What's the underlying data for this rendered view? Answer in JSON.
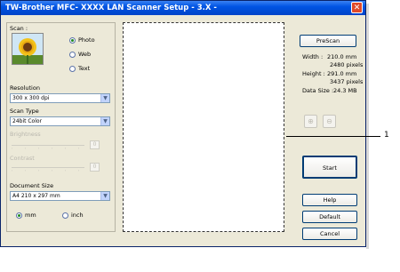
{
  "window": {
    "title": "TW-Brother MFC- XXXX     LAN Scanner Setup - 3.X -",
    "close_glyph": "✕"
  },
  "scan": {
    "label": "Scan :",
    "options": [
      "Photo",
      "Web",
      "Text"
    ],
    "selected": "Photo"
  },
  "resolution": {
    "label": "Resolution",
    "value": "300 x 300 dpi"
  },
  "scan_type": {
    "label": "Scan Type",
    "value": "24bit Color"
  },
  "brightness": {
    "label": "Brightness",
    "value": "0"
  },
  "contrast": {
    "label": "Contrast",
    "value": "0"
  },
  "document_size": {
    "label": "Document Size",
    "value": "A4 210 x 297 mm"
  },
  "units": {
    "options": [
      "mm",
      "inch"
    ],
    "selected": "mm"
  },
  "right": {
    "prescan": "PreScan",
    "width_label": "Width :",
    "width_mm": "210.0 mm",
    "width_px": "2480 pixels",
    "height_label": "Height :",
    "height_mm": "291.0 mm",
    "height_px": "3437 pixels",
    "datasize_label": "Data Size :",
    "datasize_value": "24.3 MB",
    "zoom_in": "⊕",
    "zoom_out": "⊖",
    "start": "Start",
    "help": "Help",
    "default": "Default",
    "cancel": "Cancel"
  },
  "callout": {
    "number": "1"
  }
}
